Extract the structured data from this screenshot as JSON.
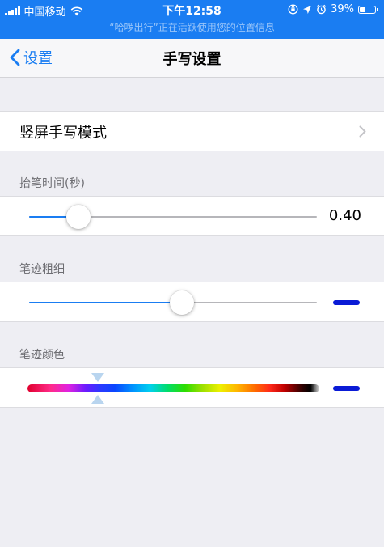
{
  "status_bar": {
    "carrier": "中国移动",
    "time": "下午12:58",
    "battery": "39%",
    "battery_level": 0.39,
    "notice": "“哈啰出行”正在活跃使用您的位置信息"
  },
  "nav": {
    "back_label": "设置",
    "title": "手写设置"
  },
  "mode_row": {
    "label": "竖屏手写模式"
  },
  "pen_lift": {
    "header": "抬笔时间(秒)",
    "value_text": "0.40",
    "level": 0.17
  },
  "stroke_width": {
    "header": "笔迹粗细",
    "level": 0.53,
    "preview_color": "#0a1bd6"
  },
  "stroke_color": {
    "header": "笔迹颜色",
    "position": 0.24,
    "preview_color": "#0a1bd6"
  },
  "colors": {
    "accent": "#1a7df2",
    "background": "#eeeef3"
  }
}
